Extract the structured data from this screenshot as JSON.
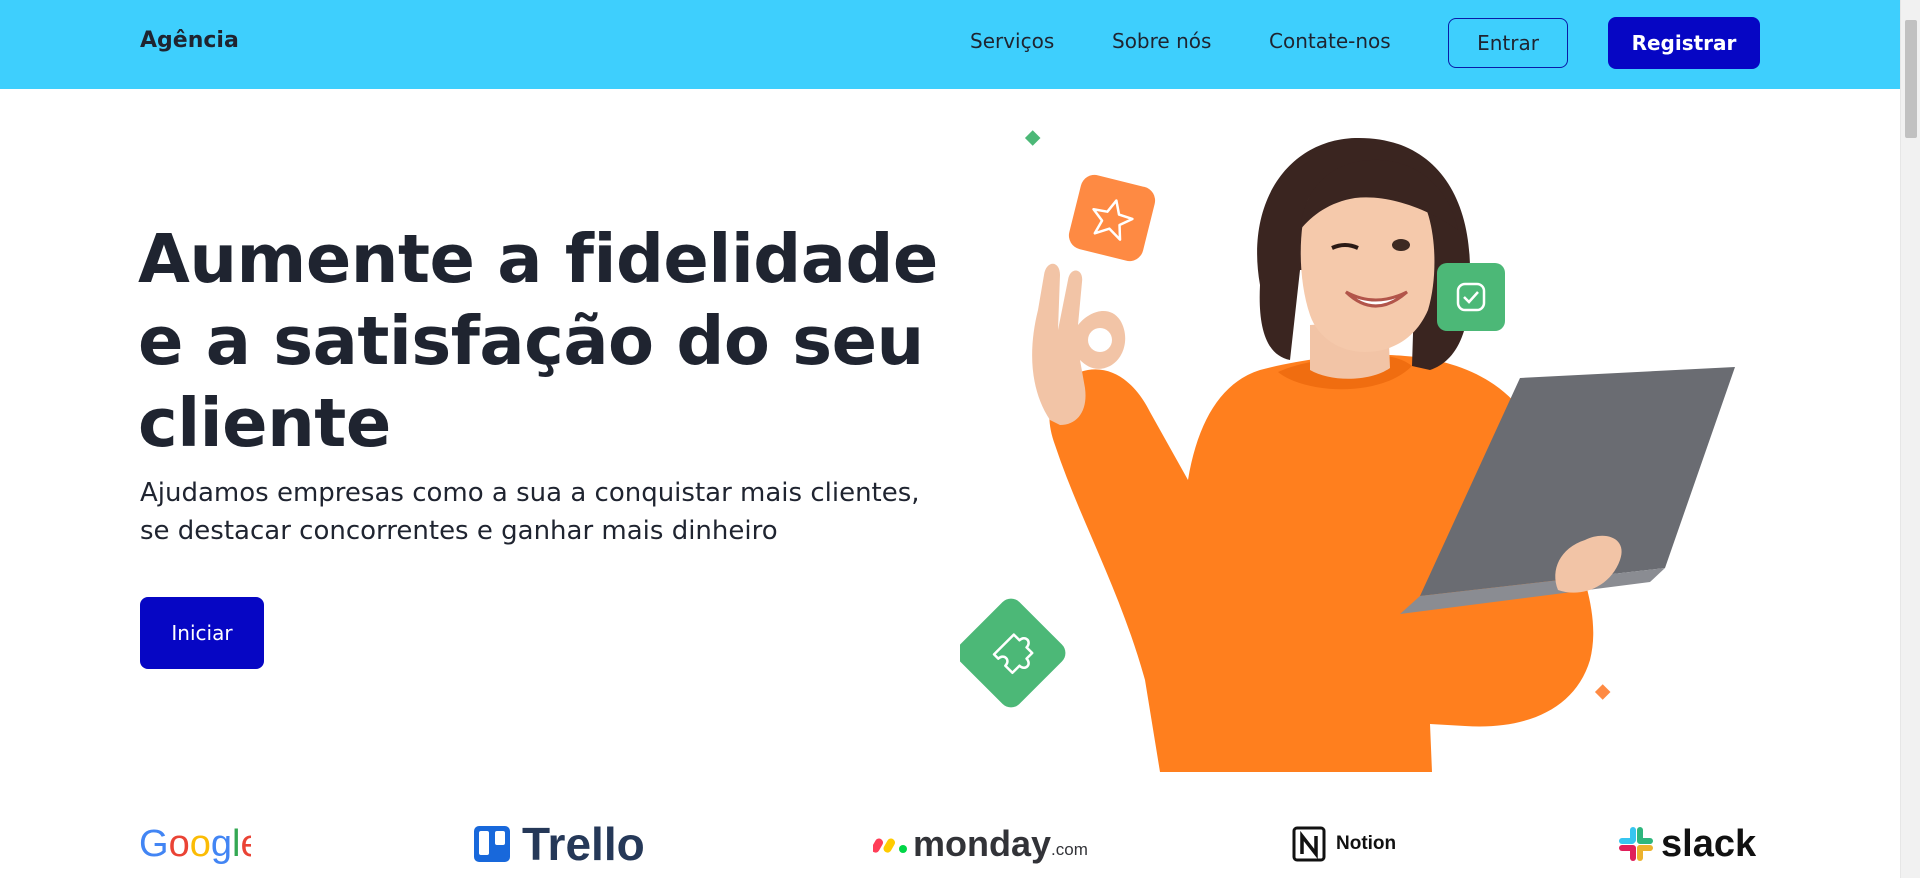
{
  "navbar": {
    "brand": "Agência",
    "links": [
      "Serviços",
      "Sobre nós",
      "Contate-nos"
    ],
    "login_label": "Entrar",
    "register_label": "Registrar"
  },
  "hero": {
    "title": "Aumente a fidelidade e a satisfação do seu cliente",
    "subtitle": "Ajudamos empresas como a sua a conquistar mais clientes, se destacar concorrentes e ganhar mais dinheiro",
    "cta_label": "Iniciar"
  },
  "logos": {
    "google": "Google",
    "trello": "Trello",
    "monday": "monday",
    "monday_suffix": ".com",
    "notion": "Notion",
    "slack": "slack"
  },
  "colors": {
    "navbar_bg": "#3ecffd",
    "primary": "#0606c4",
    "sweater_orange": "#ff7f1e",
    "accent_green": "#4cb877",
    "accent_orange": "#fe8a43"
  },
  "icons": {
    "illustration_icons": [
      "star-icon",
      "check-icon",
      "puzzle-icon"
    ]
  }
}
